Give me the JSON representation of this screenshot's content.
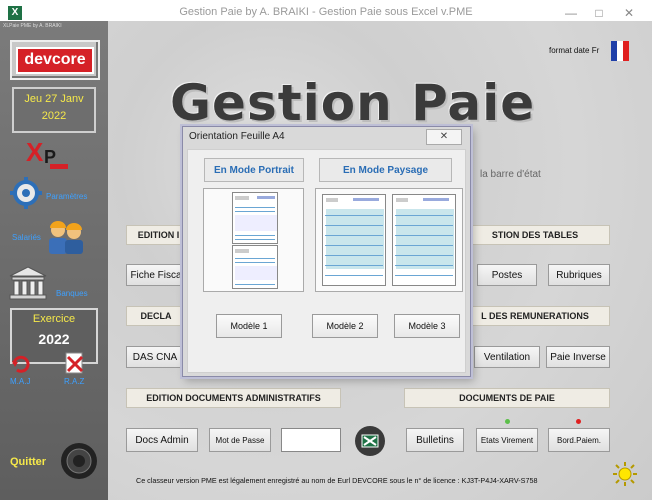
{
  "window": {
    "title": "Gestion Paie by A. BRAIKI - Gestion Paie sous Excel v.PME",
    "minimize": "—",
    "restore": "□",
    "close": "✕"
  },
  "sidebar": {
    "top_text": "XLPaie PME  by A. BRAIKI",
    "brand": "devcore",
    "date_line1": "Jeu 27 Janv",
    "date_line2": "2022",
    "params_label": "Paramètres",
    "salaries_label": "Salariés",
    "banques_label": "Banques",
    "exercice_label": "Exercice",
    "exercice_year": "2022",
    "maj_label": "M.A.J",
    "raz_label": "R.A.Z",
    "quitter_label": "Quitter"
  },
  "header": {
    "format_date": "format date Fr",
    "big_title": "Gestion Paie",
    "hint": "la barre d'état"
  },
  "main": {
    "edition_hdr": "EDITION I",
    "tables_hdr": "STION DES TABLES",
    "fiche_btn": "Fiche Fisca",
    "postes_btn": "Postes",
    "rubriques_btn": "Rubriques",
    "decl_hdr": "DECLA",
    "remun_hdr": "L DES REMUNERATIONS",
    "das_btn": "DAS CNA",
    "ventilation_btn": "Ventilation",
    "paie_inverse_btn": "Paie Inverse",
    "docs_admin_hdr": "EDITION DOCUMENTS ADMINISTRATIFS",
    "docs_paie_hdr": "DOCUMENTS DE PAIE",
    "docs_admin_btn": "Docs Admin",
    "mot_de_passe_btn": "Mot de Passe",
    "password_value": "",
    "bulletins_btn": "Bulletins",
    "etats_virement_btn": "Etats Virement",
    "bord_paiem_btn": "Bord.Paiem."
  },
  "footer": {
    "text": "Ce classeur version PME est légalement enregistré au nom de Eurl DEVCORE sous le n° de licence : KJ3T-P4J4-XARV-S758"
  },
  "modal": {
    "title": "Orientation Feuille A4",
    "portrait_label": "En Mode Portrait",
    "paysage_label": "En Mode Paysage",
    "modele1": "Modèle 1",
    "modele2": "Modèle 2",
    "modele3": "Modèle 3"
  },
  "colors": {
    "accent_yellow": "#f6e94a",
    "brand_red": "#d52127",
    "mode_blue": "#2a6db5",
    "dot_green": "#5cbf4a",
    "dot_red": "#e02020"
  }
}
